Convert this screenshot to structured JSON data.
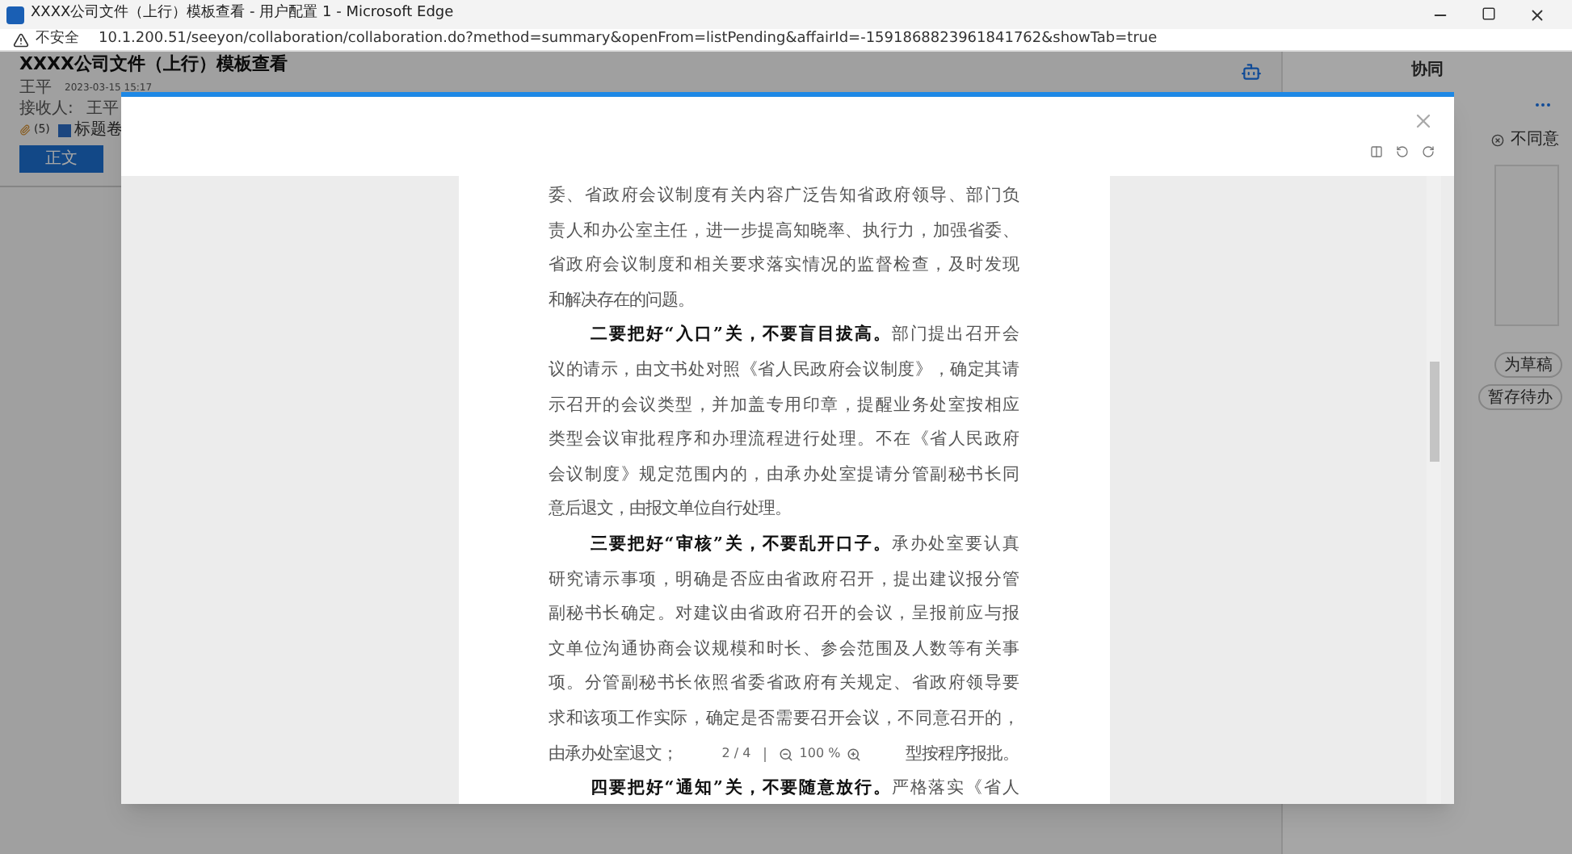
{
  "browser": {
    "title": "XXXX公司文件（上行）模板查看 - 用户配置 1 - Microsoft Edge",
    "security": "不安全",
    "url": "10.1.200.51/seeyon/collaboration/collaboration.do?method=summary&openFrom=listPending&affairId=-1591868823961841762&showTab=true"
  },
  "page": {
    "title": "XXXX公司文件（上行）模板查看",
    "sender": "王平",
    "time": "2023-03-15 15:17",
    "receiver_label": "接收人:",
    "receiver": "王平",
    "attachments": "(5)",
    "attachment_name": "标题卷",
    "body_tab": "正文"
  },
  "side_panel": {
    "title": "协同",
    "disagree": "不同意",
    "buttons": [
      "为草稿",
      "暂存待办"
    ]
  },
  "viewer": {
    "toolbar_page": "2 / 4",
    "toolbar_zoom": "100 %",
    "paragraphs": [
      {
        "lines": [
          "委、省政府会议制度有关内容广泛告知省政府领导、部门负",
          "责人和办公室主任，进一步提高知晓率、执行力，加强省委、",
          "省政府会议制度和相关要求落实情况的监督检查，及时发现",
          "和解决存在的问题。"
        ]
      },
      {
        "lines": [
          "**二要把好“入口”关，不要盲目拔高。**部门提出召开会",
          "议的请示，由文书处对照《省人民政府会议制度》，确定其请",
          "示召开的会议类型，并加盖专用印章，提醒业务处室按相应",
          "类型会议审批程序和办理流程进行处理。不在《省人民政府",
          "会议制度》规定范围内的，由承办处室提请分管副秘书长同",
          "意后退文，由报文单位自行处理。"
        ]
      },
      {
        "lines": [
          "**三要把好“审核”关，不要乱开口子。**承办处室要认真",
          "研究请示事项，明确是否应由省政府召开，提出建议报分管",
          "副秘书长确定。对建议由省政府召开的会议，呈报前应与报",
          "文单位沟通协商会议规模和时长、参会范围及人数等有关事",
          "项。分管副秘书长依照省委省政府有关规定、省政府领导要",
          "求和该项工作实际，确定是否需要召开会议，不同意召开的，"
        ],
        "covered_line": [
          "由承办处室退文；",
          "型按程序报批。"
        ]
      },
      {
        "lines": [
          "**四要把好“通知”关，不要随意放行。**严格落实《省人"
        ]
      }
    ]
  }
}
